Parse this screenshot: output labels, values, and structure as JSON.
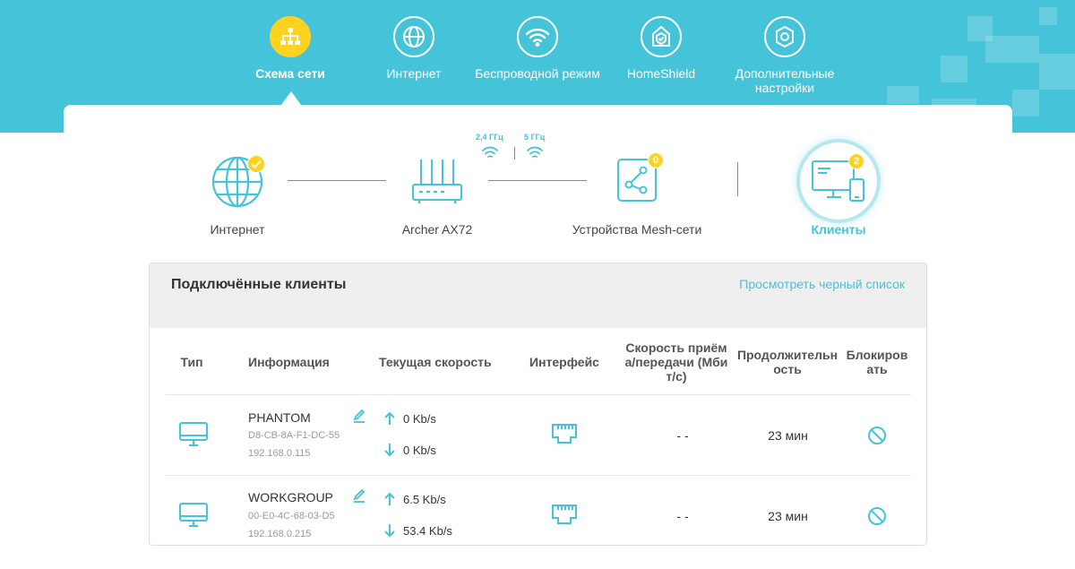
{
  "nav": {
    "items": [
      {
        "label": "Схема сети",
        "icon": "network-map-icon",
        "active": true
      },
      {
        "label": "Интернет",
        "icon": "globe-icon",
        "active": false
      },
      {
        "label": "Беспроводной режим",
        "icon": "wifi-icon",
        "active": false
      },
      {
        "label": "HomeShield",
        "icon": "shield-home-icon",
        "active": false
      },
      {
        "label": "Дополнительные настройки",
        "icon": "gear-icon",
        "active": false
      }
    ]
  },
  "topology": {
    "internet_label": "Интернет",
    "router_label": "Archer AX72",
    "band_24": "2,4 ГГц",
    "band_5": "5 ГГц",
    "mesh_label": "Устройства Mesh-сети",
    "mesh_count": "0",
    "clients_label": "Клиенты",
    "clients_count": "2"
  },
  "panel": {
    "title": "Подключённые клиенты",
    "blacklist_link": "Просмотреть черный список",
    "columns": {
      "type": "Тип",
      "info": "Информация",
      "speed": "Текущая скорость",
      "interface": "Интерфейс",
      "rate_1": "Скорость приём",
      "rate_2": "а/передачи (Мби",
      "rate_3": "т/с)",
      "duration_1": "Продолжительн",
      "duration_2": "ость",
      "block_1": "Блокиров",
      "block_2": "ать"
    },
    "rows": [
      {
        "name": "PHANTOM",
        "mac": "D8-CB-8A-F1-DC-55",
        "ip": "192.168.0.115",
        "up": "0 Kb/s",
        "down": "0 Kb/s",
        "rate": "- -",
        "duration": "23 мин"
      },
      {
        "name": "WORKGROUP",
        "mac": "00-E0-4C-68-03-D5",
        "ip": "192.168.0.215",
        "up": "6.5 Kb/s",
        "down": "53.4 Kb/s",
        "rate": "- -",
        "duration": "23 мин"
      }
    ]
  },
  "colors": {
    "accent": "#45c3d8",
    "active": "#ffd21f"
  }
}
